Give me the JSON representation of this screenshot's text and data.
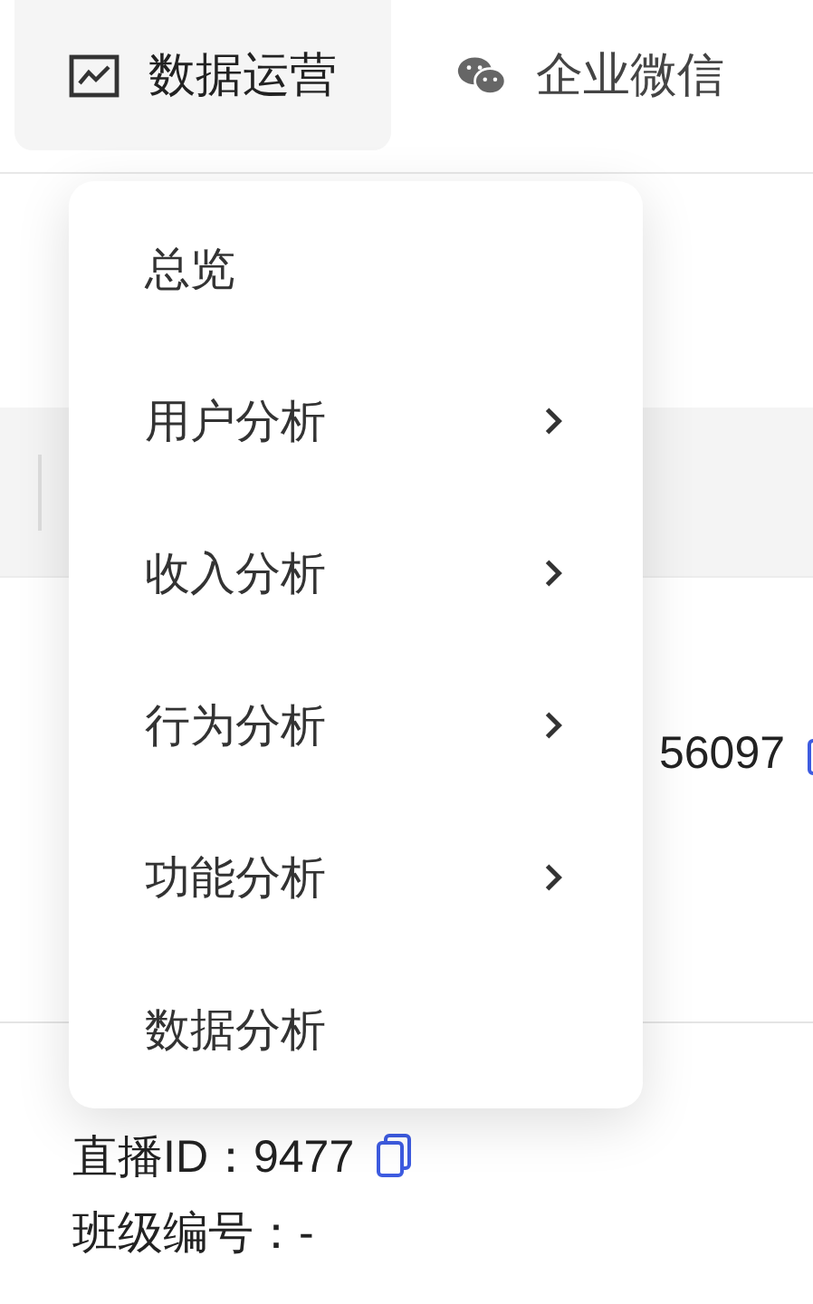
{
  "nav_tabs": [
    {
      "label": "数据运营",
      "kind": "chart",
      "selected": true
    },
    {
      "label": "企业微信",
      "kind": "chat",
      "selected": false
    }
  ],
  "table": {
    "rows": [
      {
        "kind": "covered",
        "lines": [
          {
            "text": "56097",
            "copy": true
          }
        ]
      },
      {
        "kind": "plain",
        "lines": [
          {
            "text": "直播ID：9477",
            "copy": true
          },
          {
            "text": "班级编号：-",
            "copy": false
          }
        ]
      }
    ]
  },
  "menu": {
    "items": [
      {
        "label": "总览",
        "has_submenu": false
      },
      {
        "label": "用户分析",
        "has_submenu": true
      },
      {
        "label": "收入分析",
        "has_submenu": true
      },
      {
        "label": "行为分析",
        "has_submenu": true
      },
      {
        "label": "功能分析",
        "has_submenu": true
      },
      {
        "label": "数据分析",
        "has_submenu": false
      }
    ]
  }
}
